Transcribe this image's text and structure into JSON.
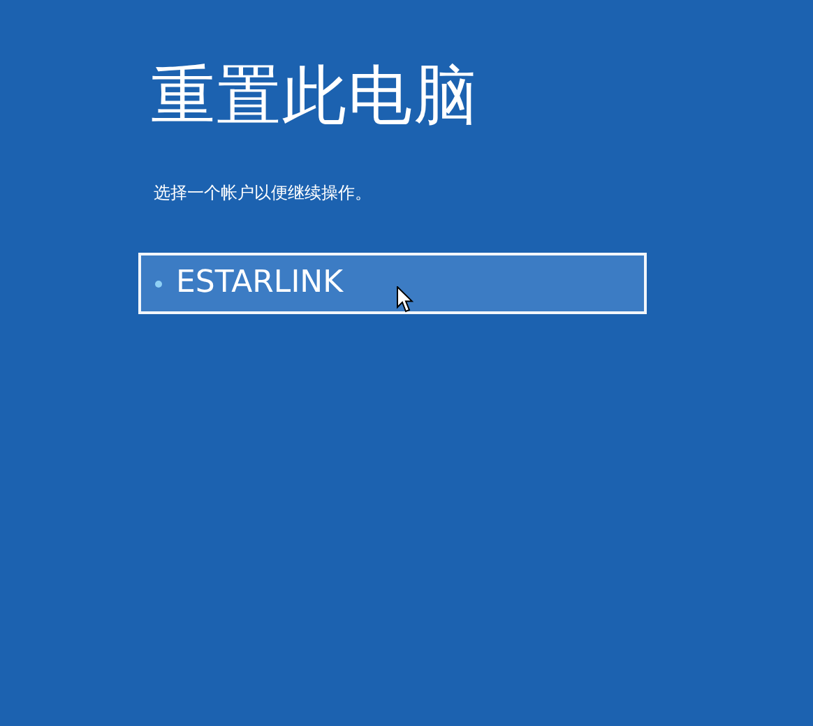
{
  "title": "重置此电脑",
  "subtitle": "选择一个帐户以便继续操作。",
  "accounts": [
    {
      "name": "ESTARLINK",
      "selected": true
    }
  ]
}
